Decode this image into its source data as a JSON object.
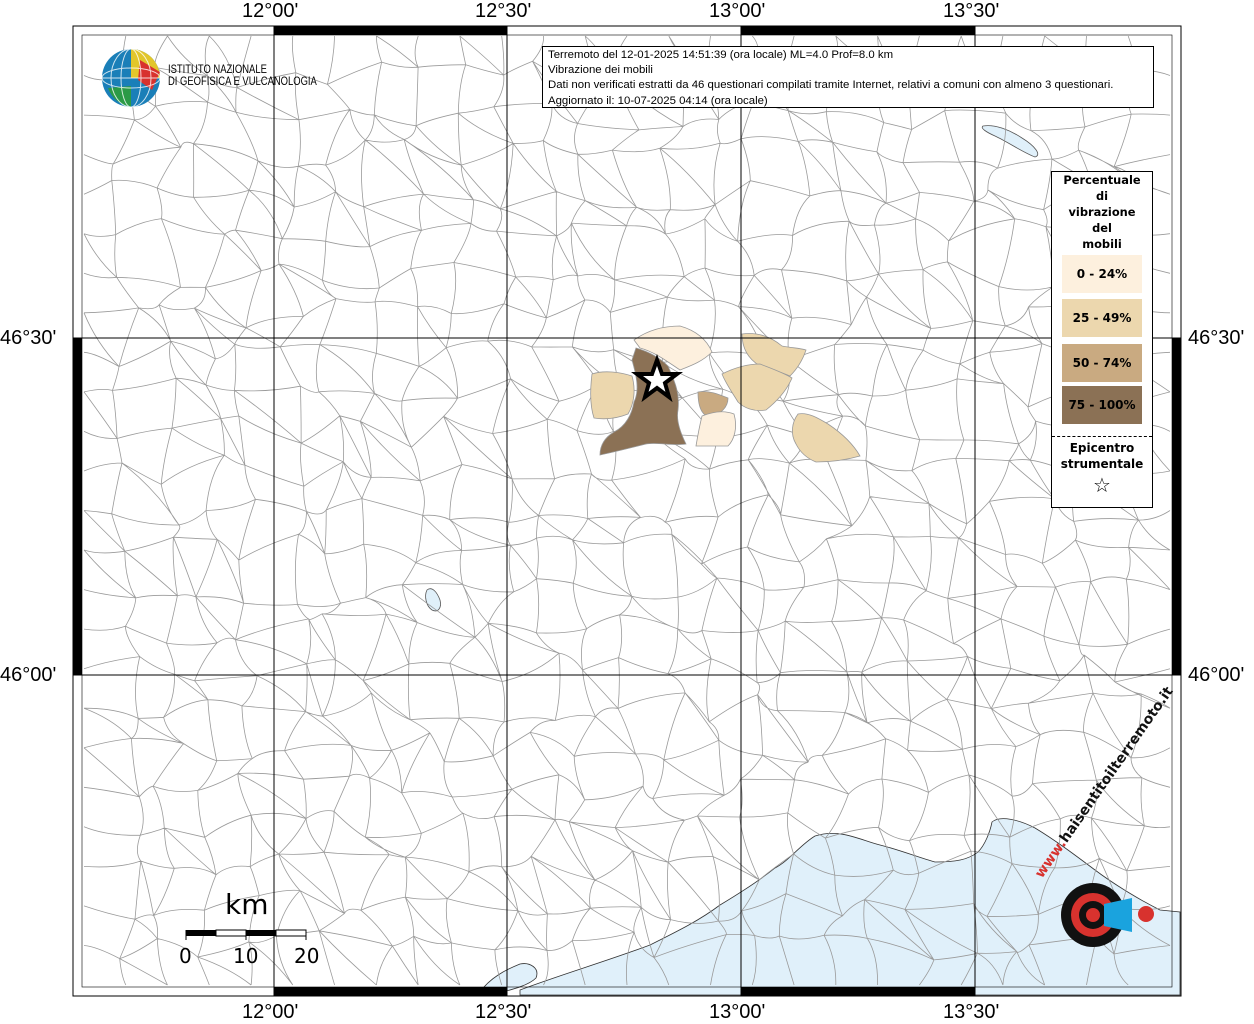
{
  "info": {
    "line1": "Terremoto del 12-01-2025 14:51:39 (ora locale) ML=4.0 Prof=8.0 km",
    "line2": "Vibrazione dei mobili",
    "line3": "Dati non verificati estratti da 46 questionari compilati tramite Internet, relativi a comuni con almeno 3 questionari.",
    "line4": "Aggiornato il: 10-07-2025 04:14 (ora locale)"
  },
  "institute": {
    "line1": "ISTITUTO NAZIONALE",
    "line2": "DI GEOFISICA E VULCANOLOGIA"
  },
  "axes": {
    "lon_top": [
      "12°00'",
      "12°30'",
      "13°00'",
      "13°30'"
    ],
    "lon_bottom": [
      "12°00'",
      "12°30'",
      "13°00'",
      "13°30'"
    ],
    "lat_left": [
      "46°30'",
      "46°00'"
    ],
    "lat_right": [
      "46°30'",
      "46°00'"
    ]
  },
  "legend": {
    "title_lines": [
      "Percentuale",
      "di",
      "vibrazione",
      "del",
      "mobili"
    ],
    "classes": [
      {
        "label": "0 - 24%",
        "color": "#fdf0de"
      },
      {
        "label": "25 - 49%",
        "color": "#ecd7ae"
      },
      {
        "label": "50 - 74%",
        "color": "#c9aa81"
      },
      {
        "label": "75 - 100%",
        "color": "#8b7155"
      }
    ],
    "epicenter_lines": [
      "Epicentro",
      "strumentale"
    ],
    "epicenter_symbol": "☆"
  },
  "scale_bar": {
    "unit": "km",
    "labels": [
      "0",
      "10",
      "20"
    ]
  },
  "brand": {
    "text": "haisentitoilterremoto.it",
    "prefix": "www."
  },
  "colors": {
    "sea": "#e0f0fa",
    "border": "#999999",
    "grid": "#000000"
  }
}
